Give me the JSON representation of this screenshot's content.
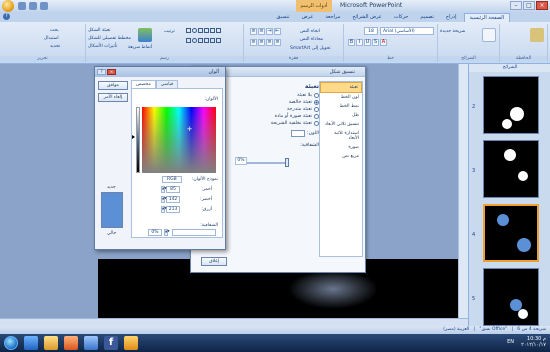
{
  "window": {
    "title": "Microsoft PowerPoint",
    "context_tab": "أدوات الرسم"
  },
  "tabs": [
    "الصفحة الرئيسية",
    "إدراج",
    "تصميم",
    "حركات",
    "عرض الشرائح",
    "مراجعة",
    "عرض",
    "تنسيق"
  ],
  "ribbon": {
    "font_name": "Arial (الأساسي)",
    "font_size": "18",
    "groups": [
      "الحافظة",
      "الشرائح",
      "خط",
      "فقرة",
      "رسم",
      "تحرير"
    ],
    "new_slide": "شريحة جديدة",
    "find": "بحث",
    "replace": "استبدال",
    "select": "تحديد",
    "arrange": "ترتيب",
    "quick_styles": "أنماط سريعة",
    "shape_fill": "تعبئة الشكل",
    "shape_outline": "مخطط تفصيلي للشكل",
    "shape_effects": "تأثيرات الأشكال",
    "text_direction": "اتجاه النص",
    "align_text": "محاذاة النص",
    "smartart": "تحويل إلى SmartArt"
  },
  "format_shape": {
    "title": "تنسيق شكل",
    "nav": [
      "تعبئة",
      "لون الخط",
      "نمط الخط",
      "ظل",
      "تنسيق ثلاثي الأبعاد",
      "استدارة ثلاثية الأبعاد",
      "صورة",
      "مربع نص"
    ],
    "section": "تعبئة",
    "options": [
      "بلا تعبئة",
      "تعبئة خالصة",
      "تعبئة متدرجة",
      "تعبئة صورة أو مادة",
      "تعبئة بخلفية الشريحة"
    ],
    "color_label": "اللون:",
    "transparency_label": "الشفافية:",
    "transparency_value": "0%",
    "close": "إغلاق"
  },
  "colors_dialog": {
    "title": "ألوان",
    "tabs": [
      "قياسي",
      "مخصص"
    ],
    "colors_label": "الألوان:",
    "model_label": "نموذج الألوان:",
    "model_value": "RGB",
    "red_label": "أحمر:",
    "red": "85",
    "green_label": "أخضر:",
    "green": "142",
    "blue_label": "أزرق:",
    "blue": "213",
    "transparency_label": "الشفافية:",
    "transparency": "0%",
    "ok": "موافق",
    "cancel": "إلغاء الأمر",
    "new_label": "جديد",
    "current_label": "حالي",
    "new_color": "#5b8fd6"
  },
  "thumbs": {
    "header": "الشرائح",
    "numbers": [
      "2",
      "3",
      "4",
      "5"
    ]
  },
  "statusbar": {
    "slide_info": "شريحة 4 من 6",
    "theme": "\"Office نسق\"",
    "language": "العربية (مصر)"
  },
  "taskbar": {
    "lang": "EN",
    "time": "10:30 م",
    "date": "٢٠١٢/١٠/١٧"
  }
}
